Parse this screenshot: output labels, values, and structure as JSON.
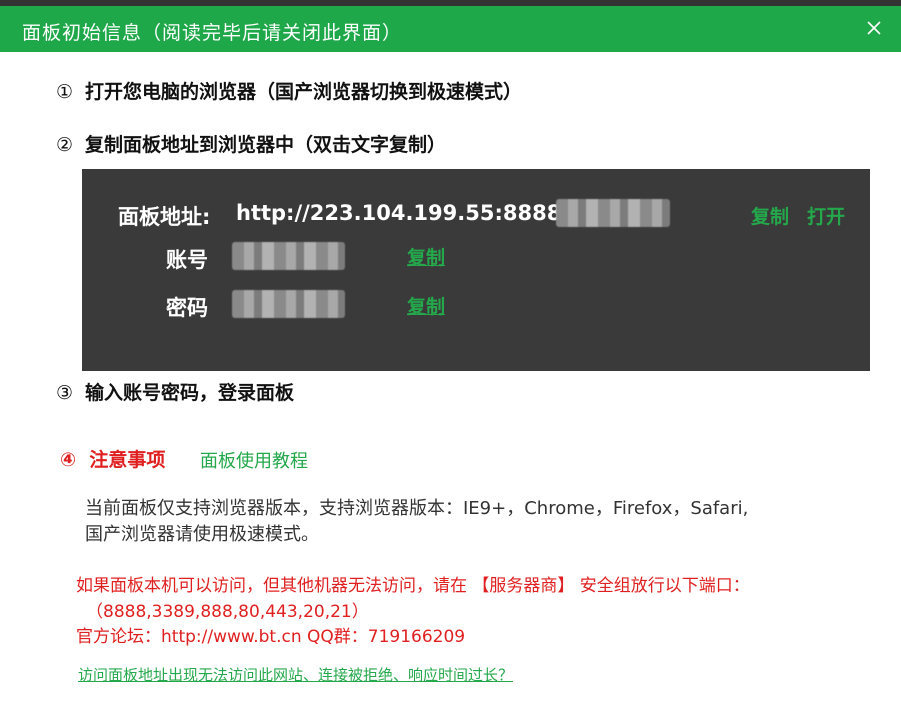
{
  "window": {
    "title": "面板初始信息（阅读完毕后请关闭此界面）",
    "close_icon": "close-icon",
    "accent_color": "#1fa84a"
  },
  "steps": [
    {
      "num": "①",
      "text": "打开您电脑的浏览器（国产浏览器切换到极速模式）"
    },
    {
      "num": "②",
      "text": "复制面板地址到浏览器中（双击文字复制）"
    },
    {
      "num": "③",
      "text": "输入账号密码，登录面板"
    }
  ],
  "info": {
    "address_label": "面板地址:",
    "address_value": "http://223.104.199.55:8888/",
    "address_copy": "复制",
    "address_open": "打开",
    "account_label": "账号",
    "account_copy": "复制",
    "password_label": "密码",
    "password_copy": "复制"
  },
  "notice": {
    "num": "④",
    "title": "注意事项",
    "tutorial_link": "面板使用教程",
    "support_text": "当前面板仅支持浏览器版本，支持浏览器版本：IE9+，Chrome，Firefox，Safari,国产浏览器请使用极速模式。",
    "port_line1": "如果面板本机可以访问，但其他机器无法访问，请在 【服务器商】 安全组放行以下端口：",
    "port_line2": "（8888,3389,888,80,443,20,21）",
    "forum_line": "官方论坛：http://www.bt.cn  QQ群：719166209",
    "bottom_link": "访问面板地址出现无法访问此网站、连接被拒绝、响应时间过长？"
  }
}
